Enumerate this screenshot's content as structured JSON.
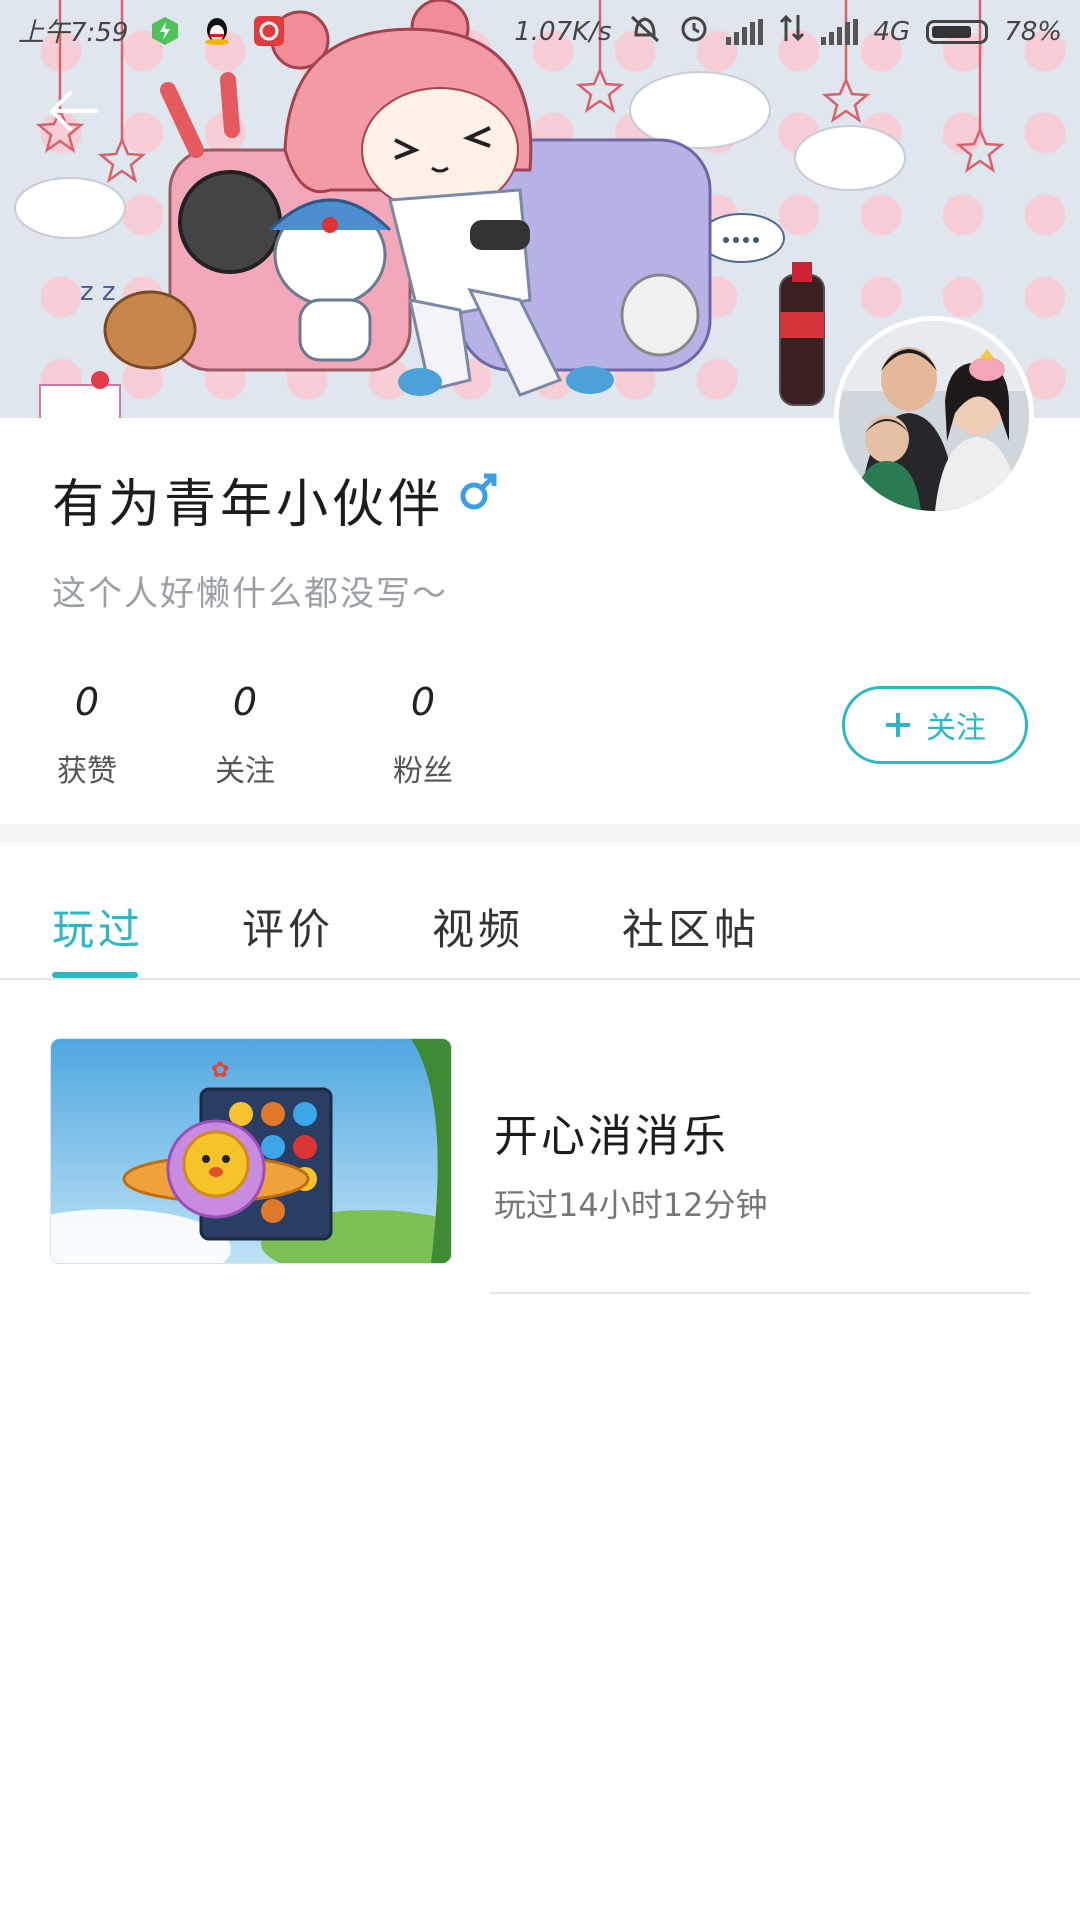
{
  "status_bar": {
    "time": "上午7:59",
    "net_speed": "1.07K/s",
    "network_type": "4G",
    "battery_text": "78%",
    "battery_level": 0.78,
    "icons": [
      "charging-app-icon",
      "qq-icon",
      "netease-music-icon",
      "mute-vibrate-icon",
      "alarm-icon",
      "signal-icon",
      "data-transfer-icon",
      "signal-icon"
    ]
  },
  "header": {
    "back_icon": "arrow-left-icon"
  },
  "profile": {
    "name": "有为青年小伙伴",
    "gender_icon": "male-icon",
    "bio": "这个人好懒什么都没写～",
    "stats": [
      {
        "value": "0",
        "label": "获赞"
      },
      {
        "value": "0",
        "label": "关注"
      },
      {
        "value": "0",
        "label": "粉丝"
      }
    ],
    "follow_button": {
      "icon": "plus-icon",
      "label": "关注"
    }
  },
  "tabs": [
    {
      "label": "玩过",
      "active": true
    },
    {
      "label": "评价",
      "active": false
    },
    {
      "label": "视频",
      "active": false
    },
    {
      "label": "社区帖",
      "active": false
    }
  ],
  "games": [
    {
      "title": "开心消消乐",
      "play_time": "玩过14小时12分钟"
    }
  ],
  "colors": {
    "accent": "#2bb8c4",
    "text_primary": "#1c1c1c",
    "text_secondary": "#9aa0a4",
    "banner_bg": "#dfe6ee",
    "banner_dots": "#f7cdd6"
  }
}
